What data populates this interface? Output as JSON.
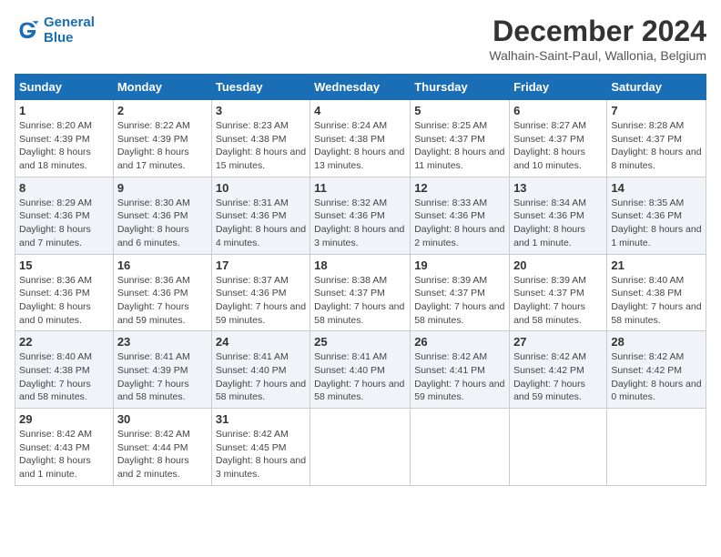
{
  "header": {
    "logo_line1": "General",
    "logo_line2": "Blue",
    "month_year": "December 2024",
    "location": "Walhain-Saint-Paul, Wallonia, Belgium"
  },
  "days_of_week": [
    "Sunday",
    "Monday",
    "Tuesday",
    "Wednesday",
    "Thursday",
    "Friday",
    "Saturday"
  ],
  "weeks": [
    [
      {
        "day": "1",
        "sunrise": "Sunrise: 8:20 AM",
        "sunset": "Sunset: 4:39 PM",
        "daylight": "Daylight: 8 hours and 18 minutes."
      },
      {
        "day": "2",
        "sunrise": "Sunrise: 8:22 AM",
        "sunset": "Sunset: 4:39 PM",
        "daylight": "Daylight: 8 hours and 17 minutes."
      },
      {
        "day": "3",
        "sunrise": "Sunrise: 8:23 AM",
        "sunset": "Sunset: 4:38 PM",
        "daylight": "Daylight: 8 hours and 15 minutes."
      },
      {
        "day": "4",
        "sunrise": "Sunrise: 8:24 AM",
        "sunset": "Sunset: 4:38 PM",
        "daylight": "Daylight: 8 hours and 13 minutes."
      },
      {
        "day": "5",
        "sunrise": "Sunrise: 8:25 AM",
        "sunset": "Sunset: 4:37 PM",
        "daylight": "Daylight: 8 hours and 11 minutes."
      },
      {
        "day": "6",
        "sunrise": "Sunrise: 8:27 AM",
        "sunset": "Sunset: 4:37 PM",
        "daylight": "Daylight: 8 hours and 10 minutes."
      },
      {
        "day": "7",
        "sunrise": "Sunrise: 8:28 AM",
        "sunset": "Sunset: 4:37 PM",
        "daylight": "Daylight: 8 hours and 8 minutes."
      }
    ],
    [
      {
        "day": "8",
        "sunrise": "Sunrise: 8:29 AM",
        "sunset": "Sunset: 4:36 PM",
        "daylight": "Daylight: 8 hours and 7 minutes."
      },
      {
        "day": "9",
        "sunrise": "Sunrise: 8:30 AM",
        "sunset": "Sunset: 4:36 PM",
        "daylight": "Daylight: 8 hours and 6 minutes."
      },
      {
        "day": "10",
        "sunrise": "Sunrise: 8:31 AM",
        "sunset": "Sunset: 4:36 PM",
        "daylight": "Daylight: 8 hours and 4 minutes."
      },
      {
        "day": "11",
        "sunrise": "Sunrise: 8:32 AM",
        "sunset": "Sunset: 4:36 PM",
        "daylight": "Daylight: 8 hours and 3 minutes."
      },
      {
        "day": "12",
        "sunrise": "Sunrise: 8:33 AM",
        "sunset": "Sunset: 4:36 PM",
        "daylight": "Daylight: 8 hours and 2 minutes."
      },
      {
        "day": "13",
        "sunrise": "Sunrise: 8:34 AM",
        "sunset": "Sunset: 4:36 PM",
        "daylight": "Daylight: 8 hours and 1 minute."
      },
      {
        "day": "14",
        "sunrise": "Sunrise: 8:35 AM",
        "sunset": "Sunset: 4:36 PM",
        "daylight": "Daylight: 8 hours and 1 minute."
      }
    ],
    [
      {
        "day": "15",
        "sunrise": "Sunrise: 8:36 AM",
        "sunset": "Sunset: 4:36 PM",
        "daylight": "Daylight: 8 hours and 0 minutes."
      },
      {
        "day": "16",
        "sunrise": "Sunrise: 8:36 AM",
        "sunset": "Sunset: 4:36 PM",
        "daylight": "Daylight: 7 hours and 59 minutes."
      },
      {
        "day": "17",
        "sunrise": "Sunrise: 8:37 AM",
        "sunset": "Sunset: 4:36 PM",
        "daylight": "Daylight: 7 hours and 59 minutes."
      },
      {
        "day": "18",
        "sunrise": "Sunrise: 8:38 AM",
        "sunset": "Sunset: 4:37 PM",
        "daylight": "Daylight: 7 hours and 58 minutes."
      },
      {
        "day": "19",
        "sunrise": "Sunrise: 8:39 AM",
        "sunset": "Sunset: 4:37 PM",
        "daylight": "Daylight: 7 hours and 58 minutes."
      },
      {
        "day": "20",
        "sunrise": "Sunrise: 8:39 AM",
        "sunset": "Sunset: 4:37 PM",
        "daylight": "Daylight: 7 hours and 58 minutes."
      },
      {
        "day": "21",
        "sunrise": "Sunrise: 8:40 AM",
        "sunset": "Sunset: 4:38 PM",
        "daylight": "Daylight: 7 hours and 58 minutes."
      }
    ],
    [
      {
        "day": "22",
        "sunrise": "Sunrise: 8:40 AM",
        "sunset": "Sunset: 4:38 PM",
        "daylight": "Daylight: 7 hours and 58 minutes."
      },
      {
        "day": "23",
        "sunrise": "Sunrise: 8:41 AM",
        "sunset": "Sunset: 4:39 PM",
        "daylight": "Daylight: 7 hours and 58 minutes."
      },
      {
        "day": "24",
        "sunrise": "Sunrise: 8:41 AM",
        "sunset": "Sunset: 4:40 PM",
        "daylight": "Daylight: 7 hours and 58 minutes."
      },
      {
        "day": "25",
        "sunrise": "Sunrise: 8:41 AM",
        "sunset": "Sunset: 4:40 PM",
        "daylight": "Daylight: 7 hours and 58 minutes."
      },
      {
        "day": "26",
        "sunrise": "Sunrise: 8:42 AM",
        "sunset": "Sunset: 4:41 PM",
        "daylight": "Daylight: 7 hours and 59 minutes."
      },
      {
        "day": "27",
        "sunrise": "Sunrise: 8:42 AM",
        "sunset": "Sunset: 4:42 PM",
        "daylight": "Daylight: 7 hours and 59 minutes."
      },
      {
        "day": "28",
        "sunrise": "Sunrise: 8:42 AM",
        "sunset": "Sunset: 4:42 PM",
        "daylight": "Daylight: 8 hours and 0 minutes."
      }
    ],
    [
      {
        "day": "29",
        "sunrise": "Sunrise: 8:42 AM",
        "sunset": "Sunset: 4:43 PM",
        "daylight": "Daylight: 8 hours and 1 minute."
      },
      {
        "day": "30",
        "sunrise": "Sunrise: 8:42 AM",
        "sunset": "Sunset: 4:44 PM",
        "daylight": "Daylight: 8 hours and 2 minutes."
      },
      {
        "day": "31",
        "sunrise": "Sunrise: 8:42 AM",
        "sunset": "Sunset: 4:45 PM",
        "daylight": "Daylight: 8 hours and 3 minutes."
      },
      null,
      null,
      null,
      null
    ]
  ]
}
